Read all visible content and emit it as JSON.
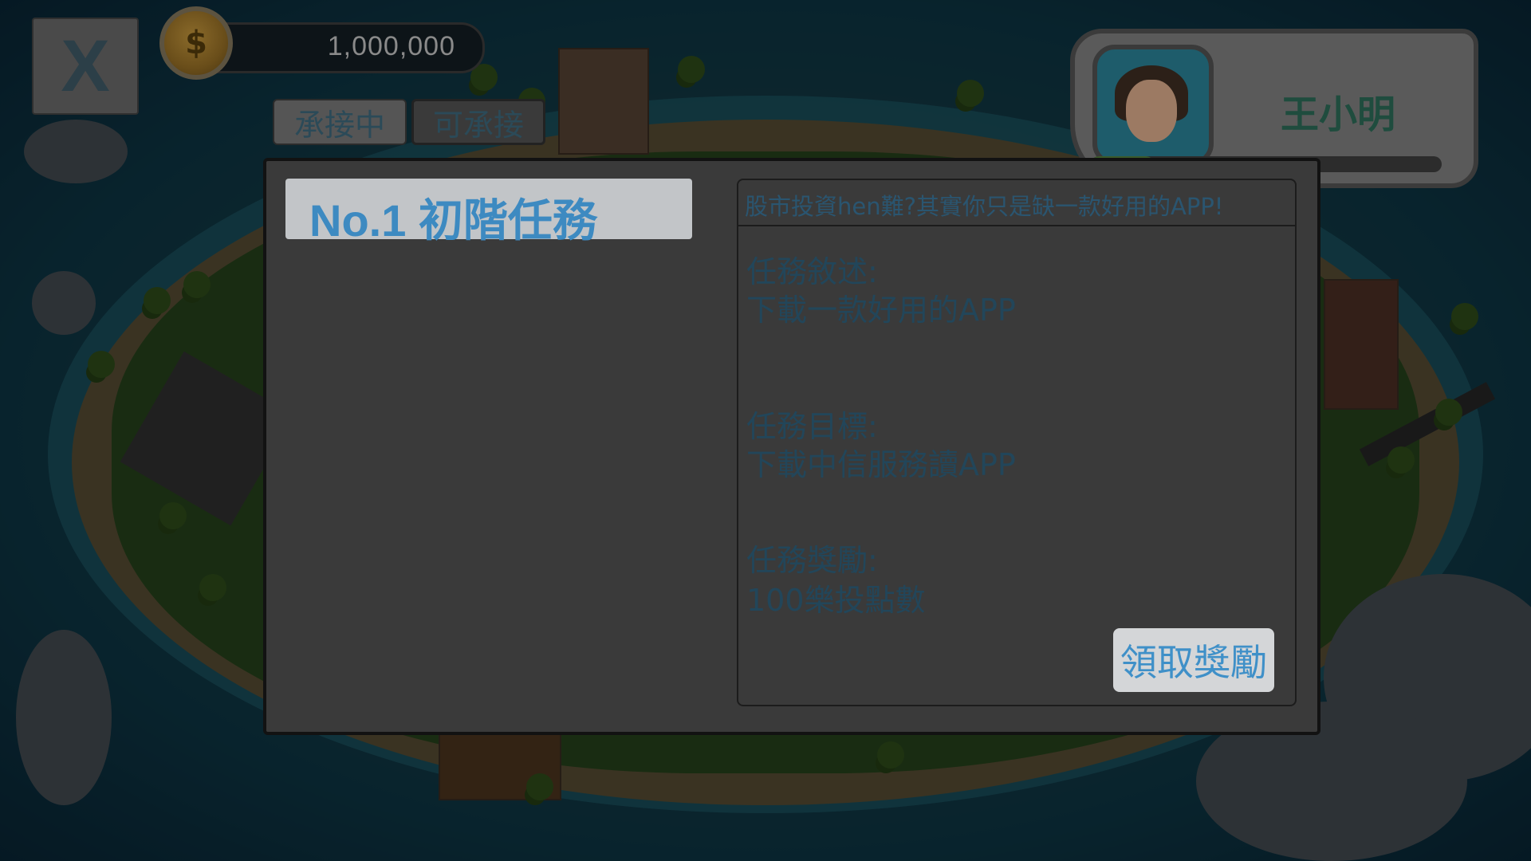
{
  "hud": {
    "close_label": "X",
    "coins": "1,000,000",
    "coin_symbol": "$",
    "tabs": [
      {
        "label": "承接中"
      },
      {
        "label": "可承接"
      }
    ],
    "player": {
      "name": "王小明",
      "xp_fraction": 0.18
    }
  },
  "dialog": {
    "mission_list": [
      {
        "label": "No.1 初階任務",
        "selected": true
      }
    ],
    "detail": {
      "header": "股市投資hen難?其實你只是缺一款好用的APP!",
      "description_title": "任務敘述:",
      "description": "下載一款好用的APP",
      "goal_title": "任務目標:",
      "goal": "下載中信服務讀APP",
      "reward_title": "任務獎勵:",
      "reward": "100樂投點數",
      "claim_label": "領取獎勵"
    }
  },
  "colors": {
    "accent_blue": "#3d8ac1",
    "overlay": "rgba(0,0,0,0.58)"
  }
}
